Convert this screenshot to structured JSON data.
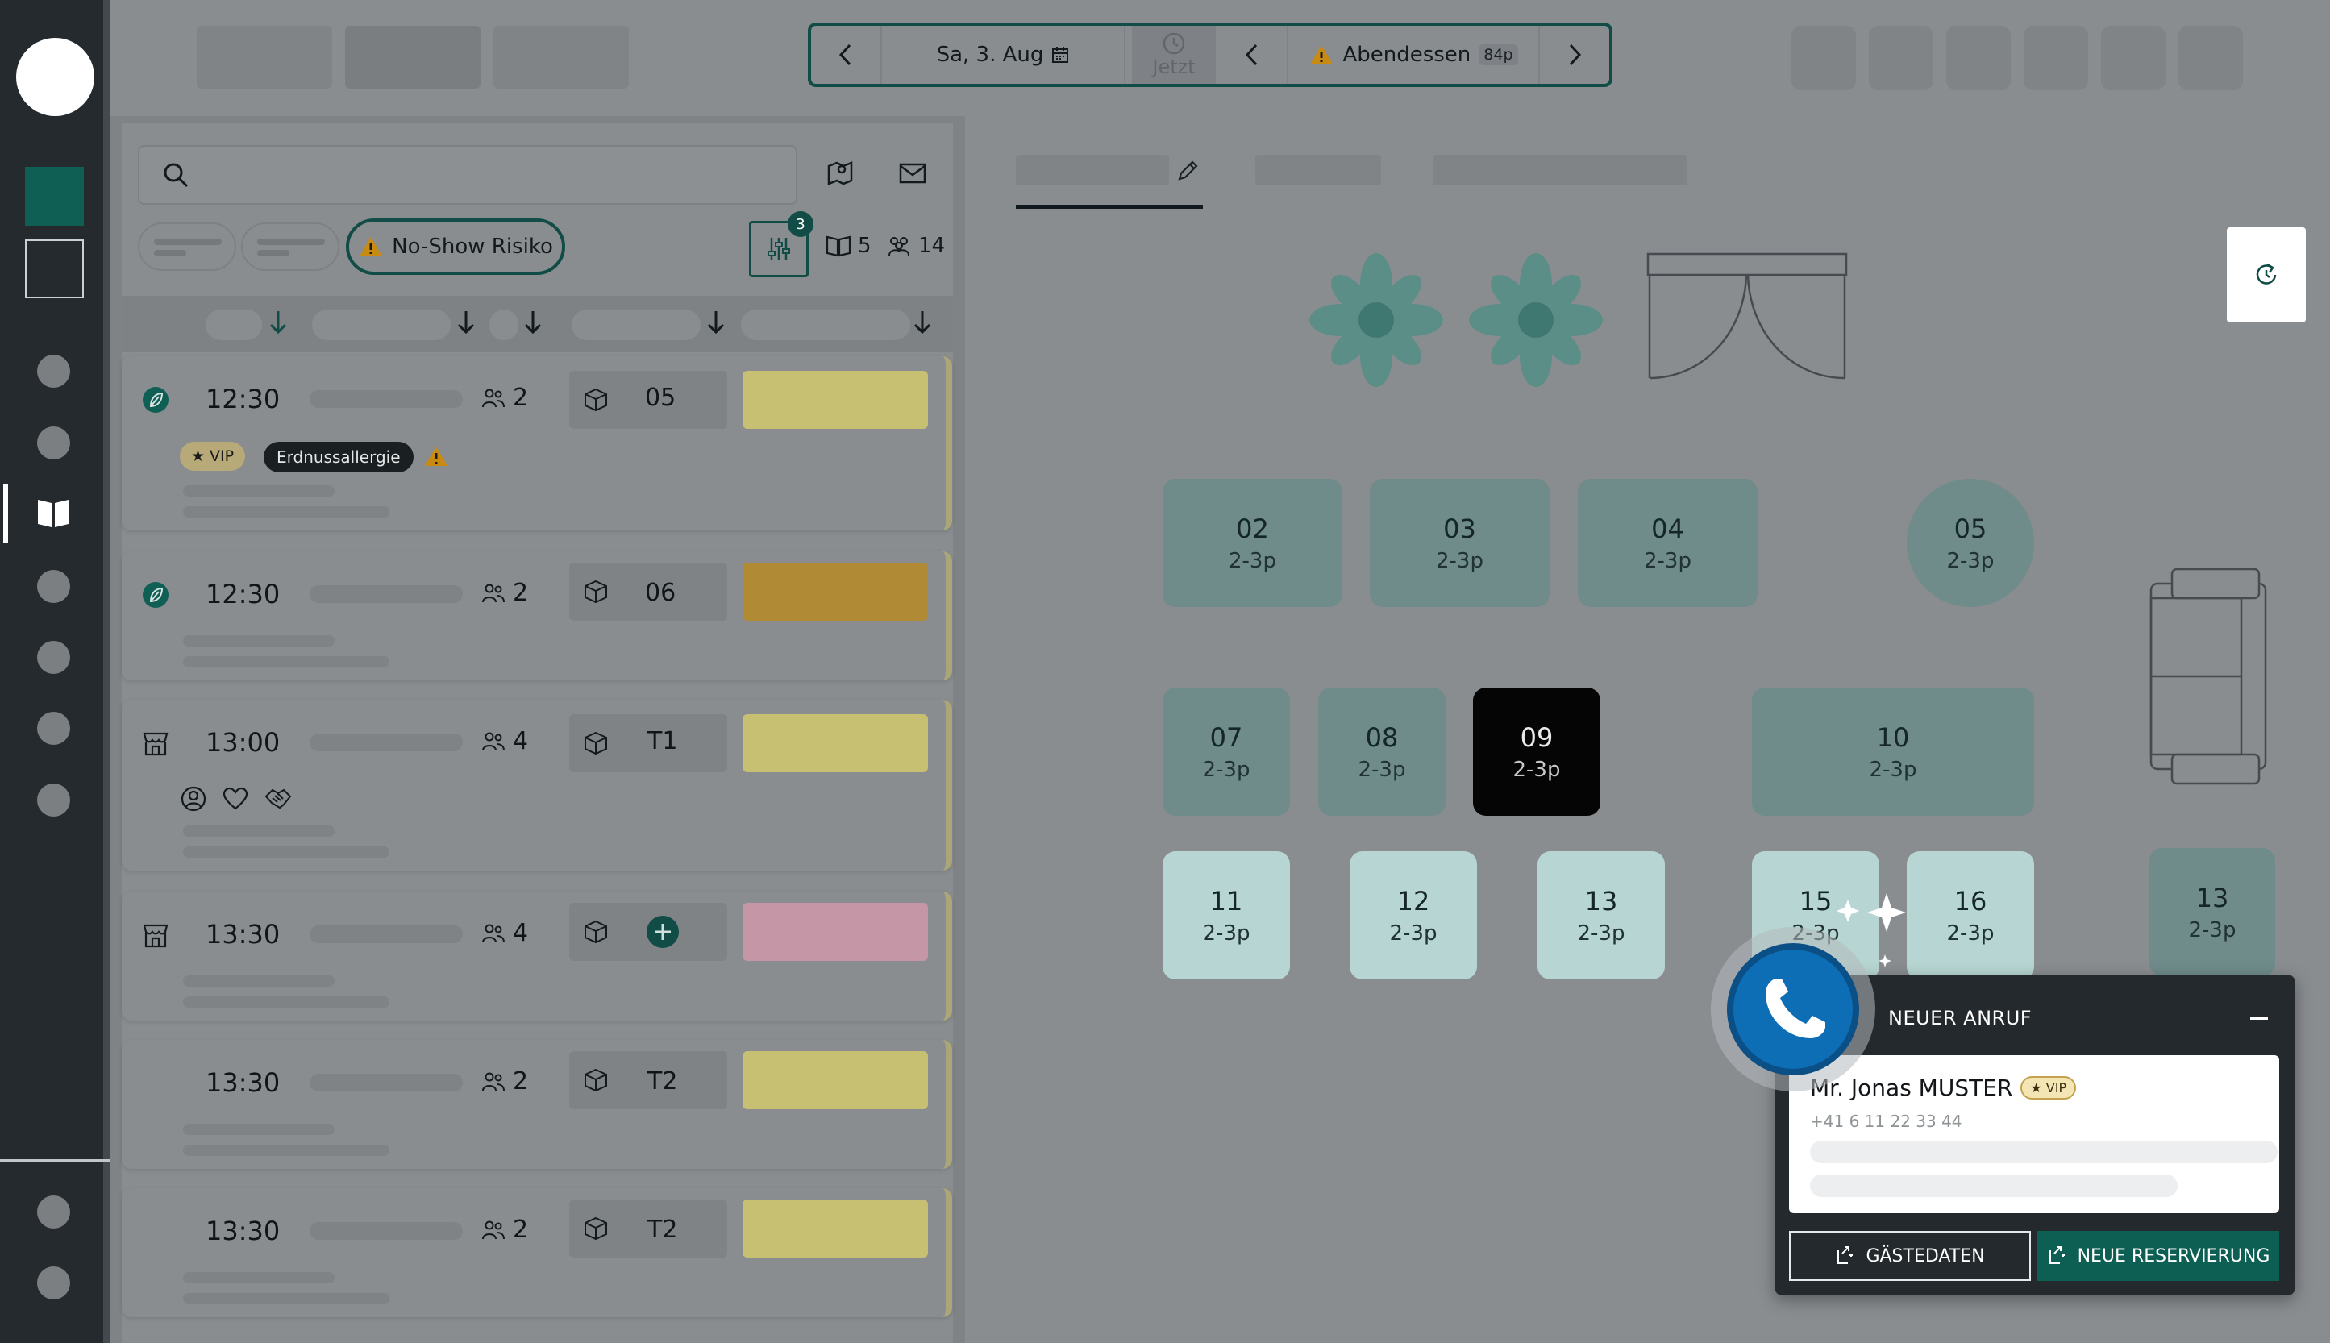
{
  "header": {
    "date_label": "Sa, 3. Aug",
    "now_label": "Jetzt",
    "service_label": "Abendessen",
    "service_badge": "84p"
  },
  "list": {
    "no_show_label": "No-Show Risiko",
    "filter_count": "3",
    "reservations_count": "5",
    "guests_count": "14",
    "cards": [
      {
        "time": "12:30",
        "guests": "2",
        "table": "05",
        "status_color": "#c7c073",
        "source_icon": "leaf-icon",
        "vip_label": "VIP",
        "allergy_label": "Erdnussallergie"
      },
      {
        "time": "12:30",
        "guests": "2",
        "table": "06",
        "status_color": "#b08a35",
        "source_icon": "leaf-icon"
      },
      {
        "time": "13:00",
        "guests": "4",
        "table": "T1",
        "status_color": "#c7c073",
        "source_icon": "store-icon"
      },
      {
        "time": "13:30",
        "guests": "4",
        "table": "",
        "status_color": "#c496a6",
        "source_icon": "store-icon"
      },
      {
        "time": "13:30",
        "guests": "2",
        "table": "T2",
        "status_color": "#c7c073",
        "source_icon": ""
      },
      {
        "time": "13:30",
        "guests": "2",
        "table": "T2",
        "status_color": "#c7c073",
        "source_icon": ""
      }
    ]
  },
  "floor": {
    "tables": [
      {
        "num": "02",
        "cap": "2-3p",
        "style": "normal"
      },
      {
        "num": "03",
        "cap": "2-3p",
        "style": "normal"
      },
      {
        "num": "04",
        "cap": "2-3p",
        "style": "normal"
      },
      {
        "num": "05",
        "cap": "2-3p",
        "style": "round"
      },
      {
        "num": "07",
        "cap": "2-3p",
        "style": "normal"
      },
      {
        "num": "08",
        "cap": "2-3p",
        "style": "normal"
      },
      {
        "num": "09",
        "cap": "2-3p",
        "style": "dark"
      },
      {
        "num": "10",
        "cap": "2-3p",
        "style": "normal"
      },
      {
        "num": "11",
        "cap": "2-3p",
        "style": "light"
      },
      {
        "num": "12",
        "cap": "2-3p",
        "style": "light"
      },
      {
        "num": "13",
        "cap": "2-3p",
        "style": "light"
      },
      {
        "num": "15",
        "cap": "2-3p",
        "style": "light"
      },
      {
        "num": "16",
        "cap": "2-3p",
        "style": "light"
      },
      {
        "num": "13",
        "cap": "2-3p",
        "style": "normal"
      }
    ]
  },
  "call": {
    "title": "NEUER ANRUF",
    "caller_name": "Mr. Jonas MUSTER",
    "vip_label": "VIP",
    "phone": "+41 6 11 22 33 44",
    "btn_guest": "GÄSTEDATEN",
    "btn_new": "NEUE RESERVIERUNG"
  },
  "colors": {
    "brand_dark_green": "#114c46",
    "action_green": "#0d5f54",
    "phone_blue": "#0d6db5"
  }
}
